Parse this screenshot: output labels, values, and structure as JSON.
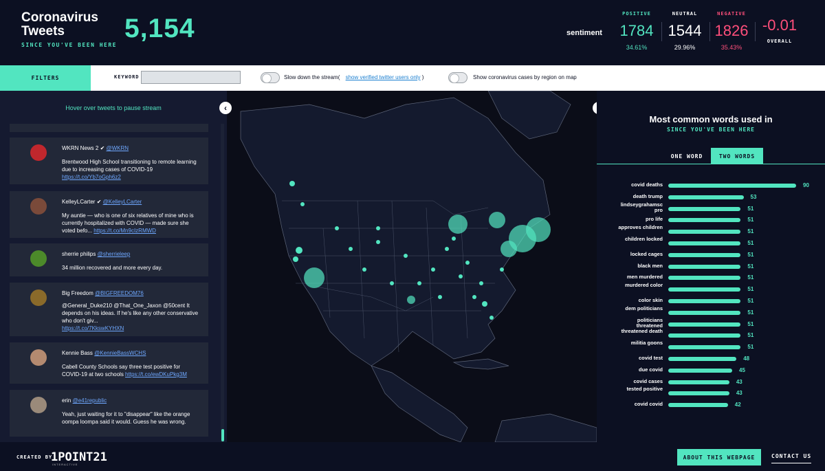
{
  "header": {
    "title": "Coronavirus Tweets",
    "since": "SINCE YOU'VE BEEN HERE",
    "tweet_count": "5,154",
    "sentiment_label": "sentiment",
    "positive": {
      "label": "POSITIVE",
      "count": "1784",
      "percent": "34.61%",
      "color": "#52e5c0"
    },
    "neutral": {
      "label": "NEUTRAL",
      "count": "1544",
      "percent": "29.96%",
      "color": "#ffffff"
    },
    "negative": {
      "label": "NEGATIVE",
      "count": "1826",
      "percent": "35.43%",
      "color": "#ff4f7b"
    },
    "overall": {
      "value": "-0.01",
      "label": "OVERALL",
      "color": "#ff4f7b"
    }
  },
  "filters": {
    "button": "FILTERS",
    "keyword_label": "KEYWORD",
    "keyword_value": "",
    "slow_down": "Slow down the stream(",
    "verified_link": "show verified twitter users only",
    "paren_close": ")",
    "show_cases": "Show coronavirus cases by region on map"
  },
  "tweets_panel": {
    "hover_note": "Hover over tweets to pause stream",
    "tweets": [
      {
        "name": "WKRN News 2 ✔",
        "handle": "@WKRN",
        "text": "Brentwood High School transitioning to remote learning due to increasing cases of COVID-19",
        "link": "https://t.co/Yb7oGph6z2",
        "avatar_color": "#c0272d"
      },
      {
        "name": "KelleyLCarter ✔",
        "handle": "@KelleyLCarter",
        "text": "My auntie — who is one of six relatives of mine who is currently hospitalized with COVID — made sure she voted befo...",
        "link": "https://t.co/Mn9cIzRMWD",
        "avatar_color": "#7a4a3a"
      },
      {
        "name": "sherrie philips",
        "handle": "@sherrieleep",
        "text": "34 million recovered and more every day.",
        "link": "",
        "avatar_color": "#4c8a2a"
      },
      {
        "name": "Big Freedom",
        "handle": "@BIGFREEDOM76",
        "text": "@General_Duke210 @That_One_Jaxon @50cent It depends on his ideas. If he's like any other conservative who don't giv...",
        "link": "https://t.co/7KkswKYHXN",
        "avatar_color": "#8a6a2a"
      },
      {
        "name": "Kennie Bass",
        "handle": "@KennieBassWCHS",
        "text": "Cabell County Schools say three test positive for COVID-19 at two schools",
        "link": "https://t.co/ewDKuPkg3M",
        "avatar_color": "#b48a70"
      },
      {
        "name": "erin",
        "handle": "@e41republic",
        "text": "Yeah, just waiting for it to \"disappear\" like the orange oompa loompa said it would. Guess he was wrong.",
        "link": "",
        "avatar_color": "#9a8a7a"
      }
    ]
  },
  "words_panel": {
    "title": "Most common words used in",
    "since": "SINCE YOU'VE BEEN HERE",
    "tab_one": "ONE WORD",
    "tab_two": "TWO WORDS",
    "active_tab": "TWO WORDS",
    "accent": "#52e5c0"
  },
  "chart_data": {
    "type": "bar",
    "orientation": "horizontal",
    "categories": [
      "covid deaths",
      "death trump",
      "lindseygrahamsc pro",
      "pro life",
      "approves children",
      "children locked",
      "locked cages",
      "black men",
      "men murdered",
      "murdered color",
      "color skin",
      "dem politicians",
      "politicians threatened",
      "threatened death",
      "militia goons",
      "covid test",
      "due covid",
      "covid cases",
      "tested positive",
      "covid covid"
    ],
    "values": [
      90,
      53,
      51,
      51,
      51,
      51,
      51,
      51,
      51,
      51,
      51,
      51,
      51,
      51,
      51,
      48,
      45,
      43,
      43,
      42
    ],
    "xlim": [
      0,
      90
    ]
  },
  "footer": {
    "created_by": "CREATED BY",
    "brand": "1POINT21",
    "brand_sub": "INTERACTIVE",
    "about": "ABOUT THIS WEBPAGE",
    "contact": "CONTACT US"
  }
}
